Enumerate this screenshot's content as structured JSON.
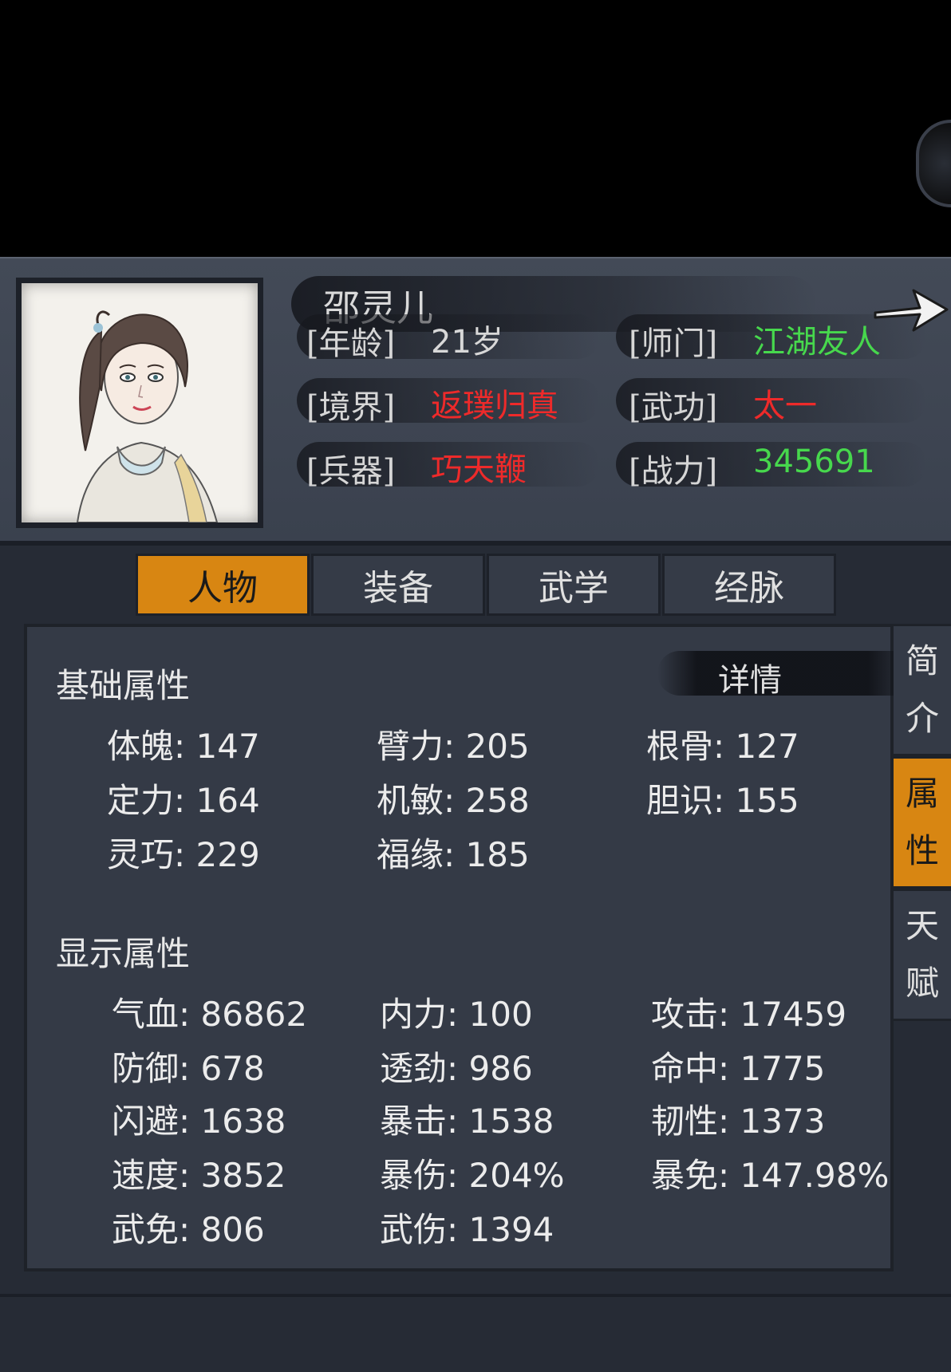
{
  "character": {
    "name": "邵灵儿",
    "age_label": "[年龄]",
    "age_value": "21岁",
    "sect_label": "[师门]",
    "sect_value": "江湖友人",
    "realm_label": "[境界]",
    "realm_value": "返璞归真",
    "martial_label": "[武功]",
    "martial_value": "太一",
    "weapon_label": "[兵器]",
    "weapon_value": "巧天鞭",
    "power_label": "[战力]",
    "power_value": "345691"
  },
  "tabs": [
    "人物",
    "装备",
    "武学",
    "经脉"
  ],
  "side_tabs": [
    {
      "line1": "简",
      "line2": "介"
    },
    {
      "line1": "属",
      "line2": "性"
    },
    {
      "line1": "天",
      "line2": "赋"
    }
  ],
  "basic": {
    "title": "基础属性",
    "detail_label": "详情",
    "stats": [
      "体魄: 147",
      "臂力: 205",
      "根骨: 127",
      "定力: 164",
      "机敏: 258",
      "胆识: 155",
      "灵巧: 229",
      "福缘: 185"
    ]
  },
  "display": {
    "title": "显示属性",
    "stats": [
      "气血: 86862",
      "内力: 100",
      "攻击: 17459",
      "防御: 678",
      "透劲: 986",
      "命中: 1775",
      "闪避: 1638",
      "暴击: 1538",
      "韧性: 1373",
      "速度: 3852",
      "暴伤: 204%",
      "暴免: 147.98%",
      "武免: 806",
      "武伤: 1394"
    ]
  },
  "colors": {
    "accent": "#d88612",
    "value_red": "#ee2a2a",
    "value_green": "#47d84d",
    "panel": "#343a46"
  },
  "icons": {
    "next": "arrow-right-icon",
    "portrait": "character-portrait"
  }
}
